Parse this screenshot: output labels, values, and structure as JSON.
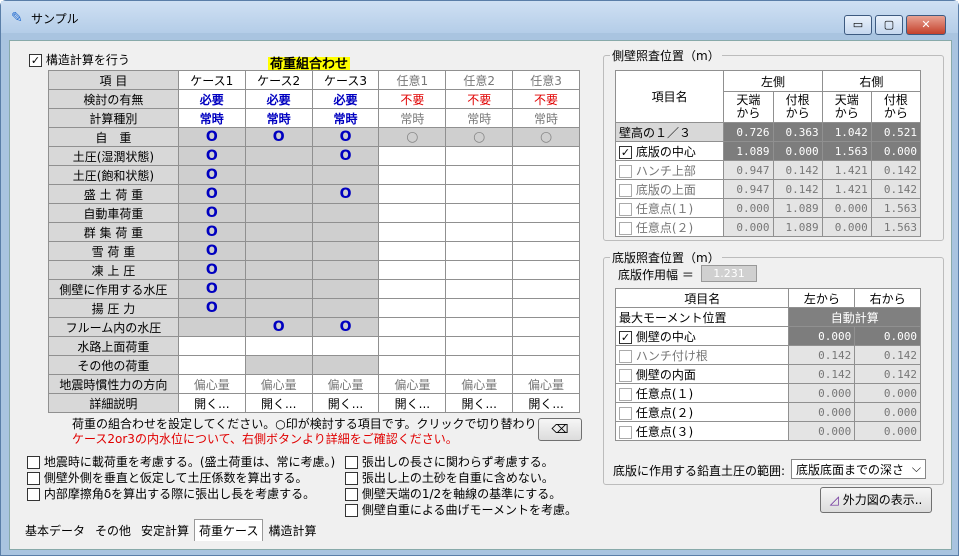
{
  "window": {
    "title": "サンプル",
    "minimize": "▭",
    "maximize": "▢",
    "close": "✕"
  },
  "structural_check": {
    "label": "構造計算を行う",
    "checked": "✓"
  },
  "load_combo": {
    "heading": "荷重組合わせ",
    "col_header_item": "項 目",
    "cases": [
      "ケース1",
      "ケース2",
      "ケース3",
      "任意1",
      "任意2",
      "任意3"
    ],
    "rows": [
      {
        "label": "検討の有無",
        "cells": [
          "必要",
          "必要",
          "必要",
          "不要",
          "不要",
          "不要"
        ]
      },
      {
        "label": "計算種別",
        "cells": [
          "常時",
          "常時",
          "常時",
          "常時",
          "常時",
          "常時"
        ]
      },
      {
        "label": "自　重",
        "cells": [
          "O",
          "O",
          "O",
          "○",
          "○",
          "○"
        ]
      },
      {
        "label": "土圧(湿潤状態)",
        "cells": [
          "O",
          "",
          "O",
          "",
          "",
          ""
        ]
      },
      {
        "label": "土圧(飽和状態)",
        "cells": [
          "O",
          "",
          "",
          "",
          "",
          ""
        ]
      },
      {
        "label": "盛 土 荷 重",
        "cells": [
          "O",
          "",
          "O",
          "",
          "",
          ""
        ]
      },
      {
        "label": "自動車荷重",
        "cells": [
          "O",
          "",
          "",
          "",
          "",
          ""
        ]
      },
      {
        "label": "群 集 荷 重",
        "cells": [
          "O",
          "",
          "",
          "",
          "",
          ""
        ]
      },
      {
        "label": "雪 荷 重",
        "cells": [
          "O",
          "",
          "",
          "",
          "",
          ""
        ]
      },
      {
        "label": "凍 上 圧",
        "cells": [
          "O",
          "",
          "",
          "",
          "",
          ""
        ]
      },
      {
        "label": "側壁に作用する水圧",
        "cells": [
          "O",
          "",
          "",
          "",
          "",
          ""
        ]
      },
      {
        "label": "揚 圧 力",
        "cells": [
          "O",
          "",
          "",
          "",
          "",
          ""
        ]
      },
      {
        "label": "フルーム内の水圧",
        "cells": [
          "",
          "O",
          "O",
          "",
          "",
          ""
        ]
      },
      {
        "label": "水路上面荷重",
        "cells": [
          "",
          "",
          "",
          "",
          "",
          ""
        ]
      },
      {
        "label": "その他の荷重",
        "cells": [
          "",
          "",
          "",
          "",
          "",
          ""
        ]
      },
      {
        "label": "地震時慣性力の方向",
        "cells": [
          "偏心量",
          "偏心量",
          "偏心量",
          "偏心量",
          "偏心量",
          "偏心量"
        ]
      },
      {
        "label": "詳細説明",
        "cells": [
          "開く...",
          "開く...",
          "開く...",
          "開く...",
          "開く...",
          "開く..."
        ]
      }
    ],
    "note1": "荷重の組合わせを設定してください。○印が検討する項目です。クリックで切り替わります。",
    "note2": "ケース2or3の内水位について、右側ボタンより詳細をご確認ください。"
  },
  "options_left": [
    "地震時に載荷重を考慮する。(盛土荷重は、常に考慮。)",
    "側壁外側を垂直と仮定して土圧係数を算出する。",
    "内部摩擦角δを算出する際に張出し長を考慮する。"
  ],
  "options_right": [
    "張出しの長さに関わらず考慮する。",
    "張出し上の土砂を自重に含めない。",
    "側壁天端の1/2を軸線の基準にする。",
    "側壁自重による曲げモーメントを考慮。"
  ],
  "side_wall": {
    "title": "側壁照査位置（m）",
    "left_side": "左側",
    "right_side": "右側",
    "item_name": "項目名",
    "sub_headers": [
      "天端\nから",
      "付根\nから",
      "天端\nから",
      "付根\nから"
    ],
    "rows": [
      {
        "label": "壁高の１／３",
        "check": "",
        "values": [
          "0.726",
          "0.363",
          "1.042",
          "0.521"
        ]
      },
      {
        "label": "底版の中心",
        "check": "✓",
        "values": [
          "1.089",
          "0.000",
          "1.563",
          "0.000"
        ]
      },
      {
        "label": "ハンチ上部",
        "check": "",
        "values": [
          "0.947",
          "0.142",
          "1.421",
          "0.142"
        ]
      },
      {
        "label": "底版の上面",
        "check": "",
        "values": [
          "0.947",
          "0.142",
          "1.421",
          "0.142"
        ]
      },
      {
        "label": "任意点(１)",
        "check": "",
        "values": [
          "0.000",
          "1.089",
          "0.000",
          "1.563"
        ]
      },
      {
        "label": "任意点(２)",
        "check": "",
        "values": [
          "0.000",
          "1.089",
          "0.000",
          "1.563"
        ]
      }
    ]
  },
  "bottom_slab": {
    "title": "底版照査位置（m）",
    "width_label": "底版作用幅 ＝",
    "width_value": "1.231",
    "item_name": "項目名",
    "from_left": "左から",
    "from_right": "右から",
    "max_moment": "最大モーメント位置",
    "auto_calc": "自動計算",
    "rows": [
      {
        "label": "側壁の中心",
        "check": "✓",
        "values": [
          "0.000",
          "0.000"
        ]
      },
      {
        "label": "ハンチ付け根",
        "check": "",
        "values": [
          "0.142",
          "0.142"
        ]
      },
      {
        "label": "側壁の内面",
        "check": "",
        "values": [
          "0.142",
          "0.142"
        ]
      },
      {
        "label": "任意点(１)",
        "check": "",
        "values": [
          "0.000",
          "0.000"
        ]
      },
      {
        "label": "任意点(２)",
        "check": "",
        "values": [
          "0.000",
          "0.000"
        ]
      },
      {
        "label": "任意点(３)",
        "check": "",
        "values": [
          "0.000",
          "0.000"
        ]
      }
    ],
    "range_label": "底版に作用する鉛直土圧の範囲:",
    "range_value": "底版底面までの深さ"
  },
  "external_force_button": "外力図の表示..",
  "tabs": [
    "基本データ",
    "その他",
    "安定計算",
    "荷重ケース",
    "構造計算"
  ],
  "active_tab": "荷重ケース"
}
